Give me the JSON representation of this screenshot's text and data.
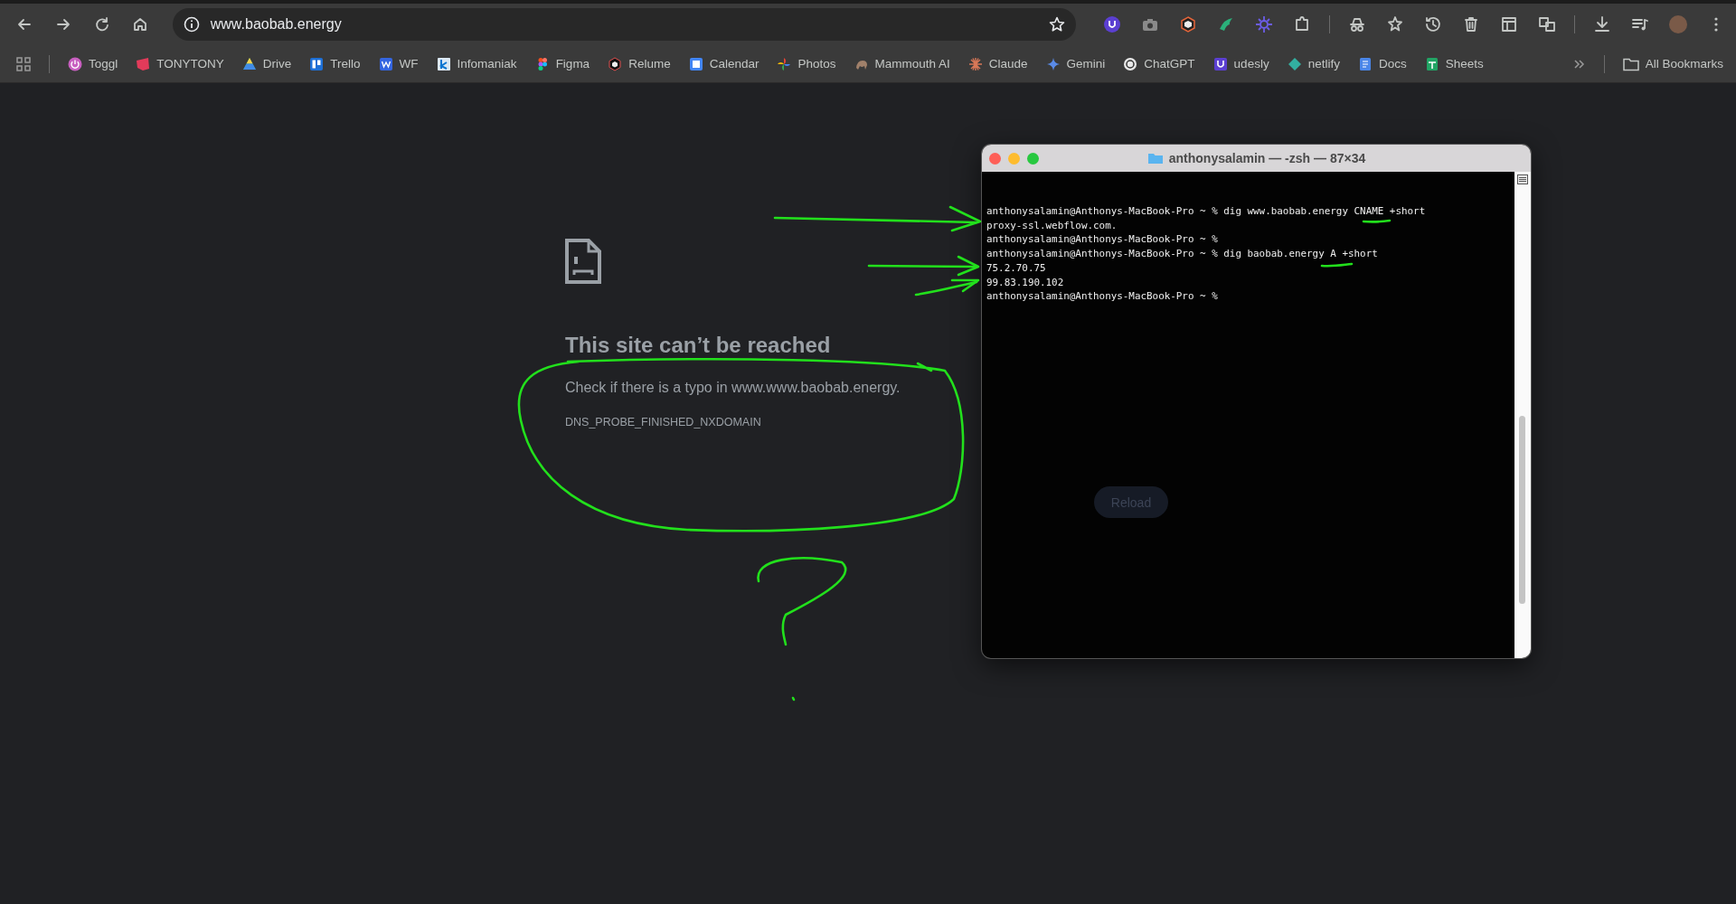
{
  "address_bar": {
    "url": "www.baobab.energy"
  },
  "bookmarks": [
    {
      "label": "Toggl"
    },
    {
      "label": "TONYTONY"
    },
    {
      "label": "Drive"
    },
    {
      "label": "Trello"
    },
    {
      "label": "WF"
    },
    {
      "label": "Infomaniak"
    },
    {
      "label": "Figma"
    },
    {
      "label": "Relume"
    },
    {
      "label": "Calendar"
    },
    {
      "label": "Photos"
    },
    {
      "label": "Mammouth AI"
    },
    {
      "label": "Claude"
    },
    {
      "label": "Gemini"
    },
    {
      "label": "ChatGPT"
    },
    {
      "label": "udesly"
    },
    {
      "label": "netlify"
    },
    {
      "label": "Docs"
    },
    {
      "label": "Sheets"
    }
  ],
  "all_bookmarks": "All Bookmarks",
  "error_page": {
    "title": "This site can’t be reached",
    "message": "Check if there is a typo in www.www.baobab.energy.",
    "code": "DNS_PROBE_FINISHED_NXDOMAIN",
    "button": "Reload"
  },
  "terminal": {
    "title": "anthonysalamin — -zsh — 87×34",
    "lines": [
      "anthonysalamin@Anthonys-MacBook-Pro ~ % dig www.baobab.energy CNAME +short",
      "proxy-ssl.webflow.com.",
      "anthonysalamin@Anthonys-MacBook-Pro ~ %",
      "anthonysalamin@Anthonys-MacBook-Pro ~ % dig baobab.energy A +short",
      "75.2.70.75",
      "99.83.190.102",
      "anthonysalamin@Anthonys-MacBook-Pro ~ %"
    ]
  }
}
